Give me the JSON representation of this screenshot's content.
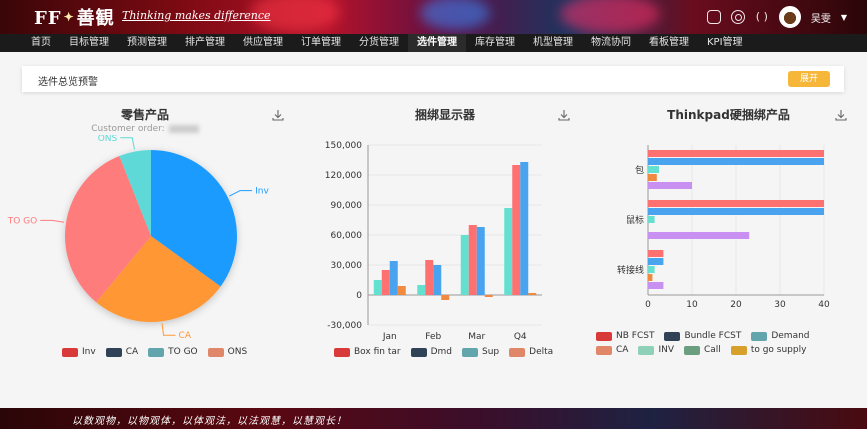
{
  "header": {
    "logo_text": "FF",
    "logo_chinese": "善観",
    "slogan": "Thinking makes difference",
    "icons": [
      "message-icon",
      "settings-icon",
      "bracket-icon"
    ],
    "user_name": "吴雯"
  },
  "nav": {
    "items": [
      "首页",
      "目标管理",
      "预测管理",
      "排产管理",
      "供应管理",
      "订单管理",
      "分货管理",
      "选件管理",
      "库存管理",
      "机型管理",
      "物流协同",
      "看板管理",
      "KPI管理"
    ],
    "active": "选件管理"
  },
  "overview": {
    "title": "选件总览预警",
    "expand_label": "展开",
    "expand_color": "#f6b63a"
  },
  "charts": {
    "retail": {
      "title": "零售产品",
      "subtitle": "Customer order:"
    },
    "bundle": {
      "title": "捆绑显示器"
    },
    "thinkpad": {
      "title": "Thinkpad硬捆绑产品"
    }
  },
  "chart_data": [
    {
      "type": "pie",
      "title": "零售产品",
      "subtitle": "Customer order:",
      "slices": [
        {
          "label": "Inv",
          "value": 35,
          "color": "#1e9bff"
        },
        {
          "label": "CA",
          "value": 26,
          "color": "#ff9736"
        },
        {
          "label": "TO GO",
          "value": 33,
          "color": "#ff7c7c"
        },
        {
          "label": "ONS",
          "value": 6,
          "color": "#5ed8d8"
        }
      ],
      "legend": [
        {
          "label": "Inv",
          "color": "#d83a3a"
        },
        {
          "label": "CA",
          "color": "#2f4256"
        },
        {
          "label": "TO GO",
          "color": "#63a5ad"
        },
        {
          "label": "ONS",
          "color": "#e0876a"
        }
      ]
    },
    {
      "type": "bar",
      "title": "捆绑显示器",
      "categories": [
        "Jan",
        "Feb",
        "Mar",
        "Q4"
      ],
      "ylim": [
        -30000,
        150000
      ],
      "yticks": [
        "150,000",
        "120,000",
        "90,000",
        "60,000",
        "30,000",
        "0",
        "-30,000"
      ],
      "series": [
        {
          "name": "Sup",
          "color": "#63e0d0",
          "values": [
            15000,
            10000,
            60000,
            87000
          ]
        },
        {
          "name": "Box fin tar",
          "color": "#ff7070",
          "values": [
            25000,
            35000,
            70000,
            130000
          ]
        },
        {
          "name": "Dmd",
          "color": "#4aa3ee",
          "values": [
            34000,
            30000,
            68000,
            133000
          ]
        },
        {
          "name": "Delta",
          "color": "#f08a3e",
          "values": [
            9000,
            -5000,
            -2000,
            2000
          ]
        }
      ],
      "legend": [
        {
          "label": "Box fin tar",
          "color": "#d83a3a"
        },
        {
          "label": "Dmd",
          "color": "#2f4256"
        },
        {
          "label": "Sup",
          "color": "#63a5ad"
        },
        {
          "label": "Delta",
          "color": "#e0876a"
        }
      ]
    },
    {
      "type": "bar",
      "orientation": "horizontal",
      "title": "Thinkpad硬捆绑产品",
      "categories": [
        "包",
        "鼠标",
        "转接线"
      ],
      "xlim": [
        0,
        40
      ],
      "xticks": [
        "0",
        "10",
        "20",
        "30",
        "40"
      ],
      "series": [
        {
          "name": "NB FCST",
          "color": "#ff7070",
          "values": [
            40,
            40,
            3.5
          ]
        },
        {
          "name": "Bundle FCST",
          "color": "#4aa3ee",
          "values": [
            40,
            40,
            3.5
          ]
        },
        {
          "name": "INV",
          "color": "#63e0d0",
          "values": [
            2.5,
            1.5,
            1.5
          ]
        },
        {
          "name": "CA",
          "color": "#f08a3e",
          "values": [
            2,
            0,
            1
          ]
        },
        {
          "name": "to go supply",
          "color": "#c890f0",
          "values": [
            10,
            23,
            3.5
          ]
        }
      ],
      "legend": [
        {
          "label": "NB FCST",
          "color": "#d83a3a"
        },
        {
          "label": "Bundle FCST",
          "color": "#2f4256"
        },
        {
          "label": "Demand",
          "color": "#63a5ad"
        },
        {
          "label": "CA",
          "color": "#e0876a"
        },
        {
          "label": "INV",
          "color": "#8ed0b8"
        },
        {
          "label": "Call",
          "color": "#6b9e7e"
        },
        {
          "label": "to go supply",
          "color": "#d6a02a"
        }
      ]
    }
  ],
  "footer": {
    "slogan": "以数观物，以物观体，以体观法，以法观慧，以慧观长！"
  }
}
